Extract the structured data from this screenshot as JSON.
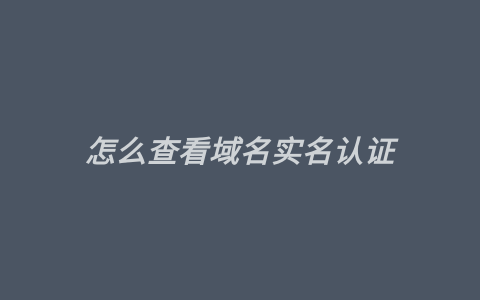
{
  "image": {
    "background_color": "#4b5563",
    "text_color": "#cfd3d6",
    "title": "怎么查看域名实名认证"
  }
}
